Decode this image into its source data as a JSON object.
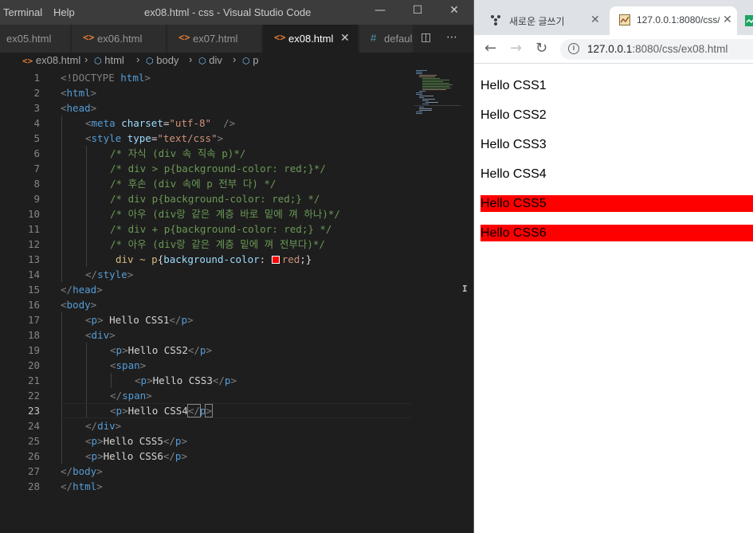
{
  "vscode": {
    "menu": [
      "Terminal",
      "Help"
    ],
    "window_title": "ex08.html - css - Visual Studio Code",
    "window_buttons": {
      "minimize": "—",
      "maximize": "☐",
      "close": "✕"
    },
    "tabs": [
      {
        "label": "ex05.html",
        "icon": "html-icon"
      },
      {
        "label": "ex06.html",
        "icon": "html-icon"
      },
      {
        "label": "ex07.html",
        "icon": "html-icon"
      },
      {
        "label": "ex08.html",
        "icon": "html-icon",
        "active": true
      },
      {
        "label": "defaul",
        "icon": "css-hash-icon"
      }
    ],
    "breadcrumb": [
      "ex08.html",
      "html",
      "body",
      "div",
      "p"
    ],
    "current_line": 23,
    "line_numbers": [
      "1",
      "2",
      "3",
      "4",
      "5",
      "6",
      "7",
      "8",
      "9",
      "10",
      "11",
      "12",
      "13",
      "14",
      "15",
      "16",
      "17",
      "18",
      "19",
      "20",
      "21",
      "22",
      "23",
      "24",
      "25",
      "26",
      "27",
      "28"
    ],
    "code": {
      "l1": {
        "a": "<!DOCTYPE ",
        "b": "html",
        "c": ">"
      },
      "l2": {
        "a": "<",
        "b": "html",
        "c": ">"
      },
      "l3": {
        "a": "<",
        "b": "head",
        "c": ">"
      },
      "l4": {
        "a": "<",
        "b": "meta",
        "c": "charset",
        "d": "=",
        "e": "\"utf-8\"",
        "f": "  />"
      },
      "l5": {
        "a": "<",
        "b": "style",
        "c": "type",
        "d": "=",
        "e": "\"text/css\"",
        "f": ">"
      },
      "l6": "/* 자식 (div 속 직속 p)*/",
      "l7": "/* div > p{background-color: red;}*/",
      "l8": "/* 후손 (div 속에 p 전부 다) */",
      "l9": "/* div p{background-color: red;} */",
      "l10": "/* 아우 (div랑 같은 계층 바로 밑에 껴 하나)*/",
      "l11": "/* div + p{background-color: red;} */",
      "l12": "/* 아우 (div랑 같은 계층 밑에 껴 전부다)*/",
      "l13": {
        "sel": "div ~ p",
        "open": "{",
        "prop": "background-color",
        "colon": ": ",
        "val": "red",
        "close": ";}"
      },
      "l14": {
        "a": "</",
        "b": "style",
        "c": ">"
      },
      "l15": {
        "a": "</",
        "b": "head",
        "c": ">"
      },
      "l16": {
        "a": "<",
        "b": "body",
        "c": ">"
      },
      "l17": {
        "a": "<",
        "b": "p",
        "c": ">",
        "text": " Hello CSS1",
        "d": "</",
        "e": "p",
        "f": ">"
      },
      "l18": {
        "a": "<",
        "b": "div",
        "c": ">"
      },
      "l19": {
        "a": "<",
        "b": "p",
        "c": ">",
        "text": "Hello CSS2",
        "d": "</",
        "e": "p",
        "f": ">"
      },
      "l20": {
        "a": "<",
        "b": "span",
        "c": ">"
      },
      "l21": {
        "a": "<",
        "b": "p",
        "c": ">",
        "text": "Hello CSS3",
        "d": "</",
        "e": "p",
        "f": ">"
      },
      "l22": {
        "a": "</",
        "b": "span",
        "c": ">"
      },
      "l23": {
        "a": "<",
        "b": "p",
        "c": ">",
        "text": "Hello CSS4",
        "d": "</",
        "e": "p",
        "f": ">"
      },
      "l24": {
        "a": "</",
        "b": "div",
        "c": ">"
      },
      "l25": {
        "a": "<",
        "b": "p",
        "c": ">",
        "text": "Hello CSS5",
        "d": "</",
        "e": "p",
        "f": ">"
      },
      "l26": {
        "a": "<",
        "b": "p",
        "c": ">",
        "text": "Hello CSS6",
        "d": "</",
        "e": "p",
        "f": ">"
      },
      "l27": {
        "a": "</",
        "b": "body",
        "c": ">"
      },
      "l28": {
        "a": "</",
        "b": "html",
        "c": ">"
      }
    },
    "colors": {
      "keyword": "#569cd6",
      "attribute": "#9cdcfe",
      "string": "#ce9178",
      "comment": "#6a9955",
      "selector": "#d7ba7d",
      "swatch": "#ff0000"
    }
  },
  "chrome": {
    "tabs": [
      {
        "label": "새로운 글쓰기",
        "close": "✕"
      },
      {
        "label": "127.0.0.1:8080/css/",
        "close": "✕",
        "active": true
      }
    ],
    "nav": {
      "back": "←",
      "forward": "→",
      "reload": "↻"
    },
    "url": {
      "host": "127.0.0.1",
      "rest": ":8080/css/ex08.html"
    },
    "page_lines": [
      {
        "text": "Hello CSS1",
        "highlight": false
      },
      {
        "text": "Hello CSS2",
        "highlight": false
      },
      {
        "text": "Hello CSS3",
        "highlight": false
      },
      {
        "text": "Hello CSS4",
        "highlight": false
      },
      {
        "text": "Hello CSS5",
        "highlight": true
      },
      {
        "text": "Hello CSS6",
        "highlight": true
      }
    ],
    "highlight_color": "#ff0000"
  }
}
